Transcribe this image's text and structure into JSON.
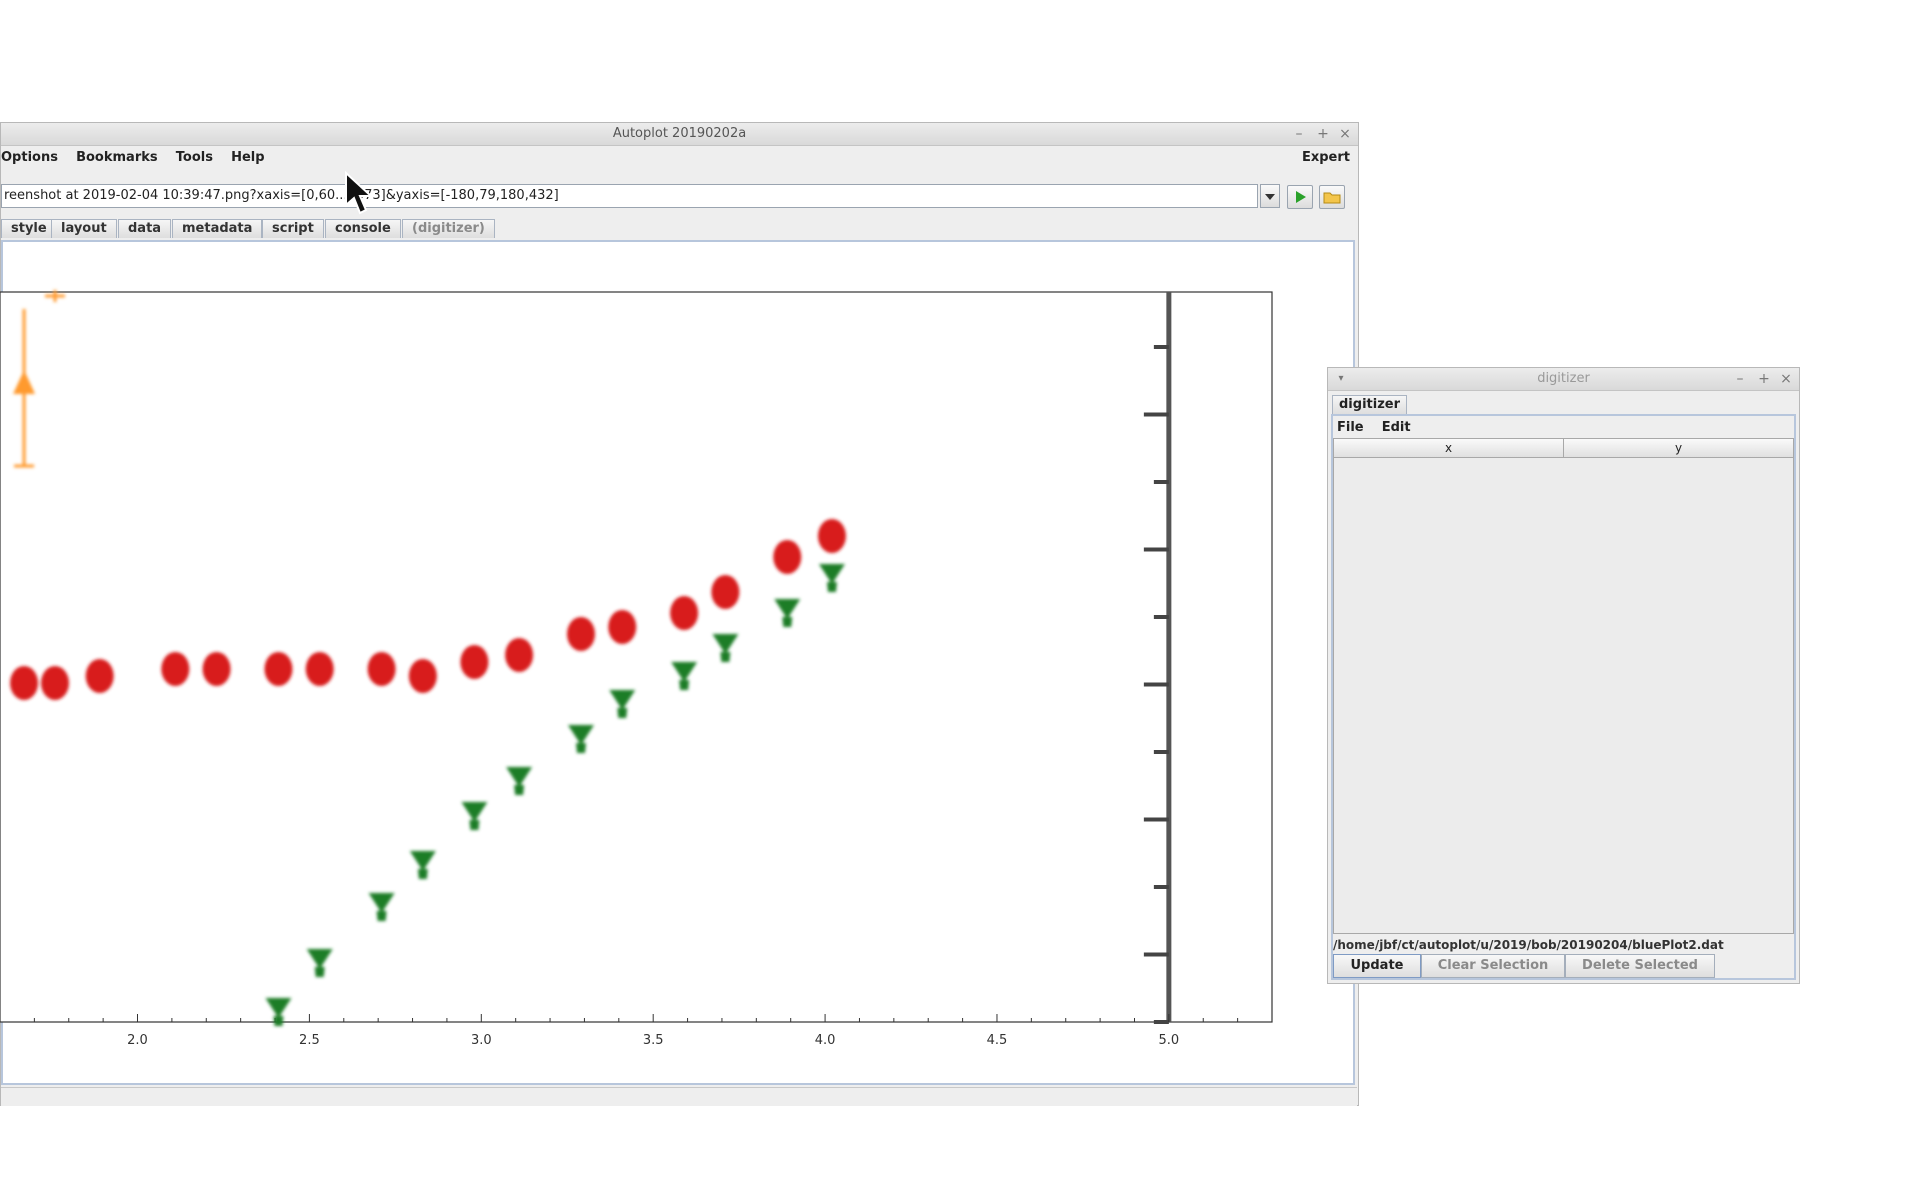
{
  "main_window": {
    "title": "Autoplot 20190202a",
    "menu": [
      "Options",
      "Bookmarks",
      "Tools",
      "Help"
    ],
    "expert_label": "Expert",
    "uri_value": "reenshot at 2019-02-04 10:39:47.png?xaxis=[0,60...1073]&yaxis=[-180,79,180,432]",
    "tabs": [
      {
        "label": "style",
        "enabled": true
      },
      {
        "label": "layout",
        "enabled": true
      },
      {
        "label": "data",
        "enabled": true
      },
      {
        "label": "metadata",
        "enabled": true
      },
      {
        "label": "script",
        "enabled": true
      },
      {
        "label": "console",
        "enabled": true
      },
      {
        "label": "(digitizer)",
        "enabled": false
      }
    ]
  },
  "chart_data": {
    "type": "scatter",
    "x_ticks": [
      "2.0",
      "2.5",
      "3.0",
      "3.5",
      "4.0",
      "4.5",
      "5.0"
    ],
    "xlim": [
      1.6,
      5.3
    ],
    "series": [
      {
        "color": "#d81b1b",
        "x": [
          1.67,
          1.76,
          1.89,
          2.11,
          2.23,
          2.41,
          2.53,
          2.71,
          2.83,
          2.98,
          3.11,
          3.29,
          3.41,
          3.59,
          3.71,
          3.89,
          4.02
        ],
        "y": [
          0.47,
          0.47,
          0.48,
          0.49,
          0.49,
          0.49,
          0.49,
          0.49,
          0.48,
          0.5,
          0.51,
          0.54,
          0.55,
          0.57,
          0.6,
          0.65,
          0.68
        ]
      },
      {
        "color": "#1d7d28",
        "x": [
          2.41,
          2.53,
          2.71,
          2.83,
          2.98,
          3.11,
          3.29,
          3.41,
          3.59,
          3.71,
          3.89,
          4.02
        ],
        "y": [
          0.0,
          0.07,
          0.15,
          0.21,
          0.28,
          0.33,
          0.39,
          0.44,
          0.48,
          0.52,
          0.57,
          0.62
        ]
      },
      {
        "color": "#ff9a2e",
        "x": [
          1.67,
          1.76
        ],
        "y": [
          0.9,
          0.99
        ]
      }
    ]
  },
  "digitizer": {
    "title": "digitizer",
    "tab": "digitizer",
    "menu": [
      "File",
      "Edit"
    ],
    "columns": [
      "x",
      "y"
    ],
    "file_path": "/home/jbf/ct/autoplot/u/2019/bob/20190204/bluePlot2.dat",
    "buttons": [
      {
        "label": "Update",
        "enabled": true
      },
      {
        "label": "Clear Selection",
        "enabled": false
      },
      {
        "label": "Delete Selected",
        "enabled": false
      }
    ]
  }
}
